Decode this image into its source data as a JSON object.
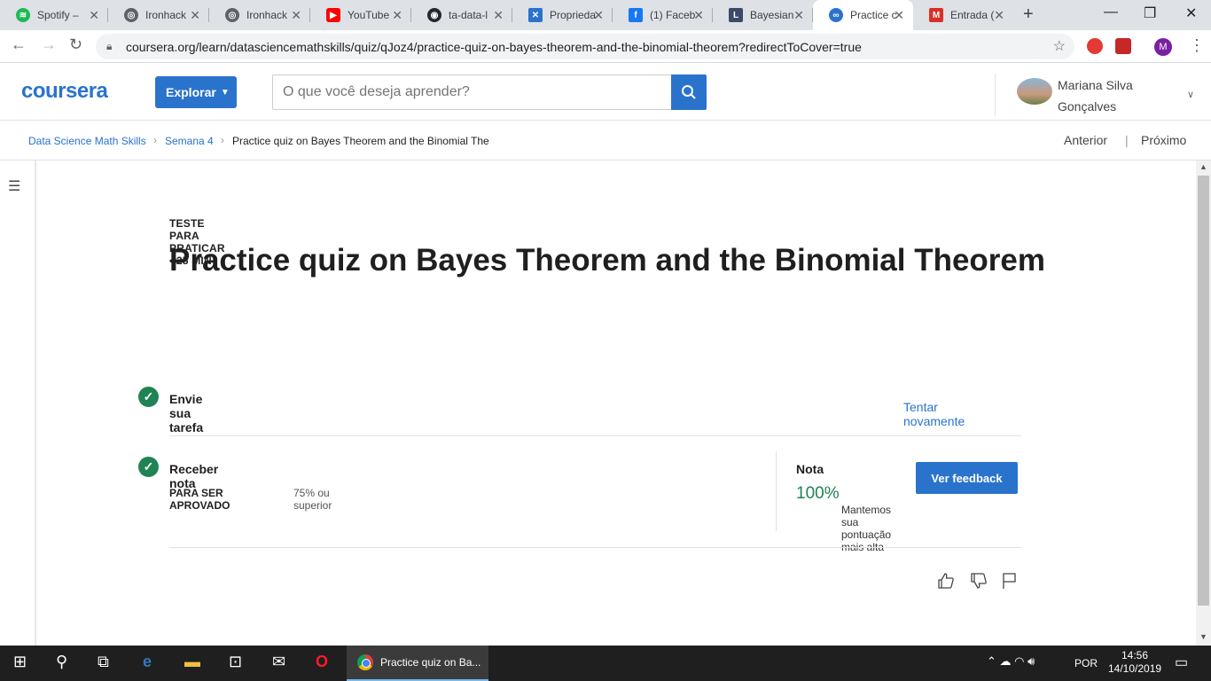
{
  "browser": {
    "tabs": [
      {
        "title": "Spotify –",
        "icon": "spotify-icon",
        "color": "#1db954"
      },
      {
        "title": "Ironhack",
        "icon": "globe-icon",
        "color": "#5f6368"
      },
      {
        "title": "Ironhack",
        "icon": "globe-icon",
        "color": "#5f6368"
      },
      {
        "title": "YouTube",
        "icon": "youtube-icon",
        "color": "#ff0000"
      },
      {
        "title": "ta-data-l",
        "icon": "github-icon",
        "color": "#24292e"
      },
      {
        "title": "Proprieda",
        "icon": "site-icon",
        "color": "#2a73cc"
      },
      {
        "title": "(1) Faceb",
        "icon": "facebook-icon",
        "color": "#1877f2"
      },
      {
        "title": "Bayesian",
        "icon": "site-icon",
        "color": "#3b4a6b"
      },
      {
        "title": "Practice c",
        "icon": "coursera-icon",
        "color": "#2a73cc"
      },
      {
        "title": "Entrada (",
        "icon": "gmail-icon",
        "color": "#d93025"
      }
    ],
    "url": "coursera.org/learn/datasciencemathskills/quiz/qJoz4/practice-quiz-on-bayes-theorem-and-the-binomial-theorem?redirectToCover=true",
    "profile_initial": "M"
  },
  "header": {
    "logo": "coursera",
    "explore_label": "Explorar",
    "search_placeholder": "O que você deseja aprender?",
    "user_name_line1": "Mariana Silva",
    "user_name_line2": "Gonçalves"
  },
  "breadcrumb": {
    "items": [
      "Data Science Math Skills",
      "Semana 4",
      "Practice quiz on Bayes Theorem and the Binomial The"
    ],
    "prev_label": "Anterior",
    "next_label": "Próximo"
  },
  "quiz": {
    "eyebrow": "TESTE PARA PRATICAR • 25 MIN",
    "title": "Practice quiz on Bayes Theorem and the Binomial Theorem",
    "step1_title": "Envie sua tarefa",
    "retry_label": "Tentar novamente",
    "step2_title": "Receber nota",
    "pass_label": "PARA SER APROVADO",
    "pass_value": "75% ou superior",
    "grade_label": "Nota",
    "grade_value": "100%",
    "feedback_label": "Ver feedback",
    "keep_note": "Mantemos sua pontuação mais alta"
  },
  "taskbar": {
    "app_title": "Practice quiz on Ba...",
    "language": "POR",
    "time": "14:56",
    "date": "14/10/2019"
  }
}
